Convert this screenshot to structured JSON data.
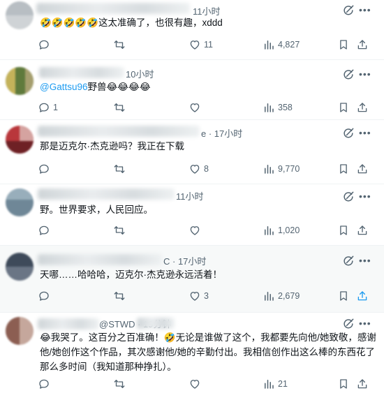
{
  "replies": [
    {
      "time": "11小时",
      "text": "🤣🤣🤣🤣🤣这太准确了，也很有趣，xddd",
      "comments": "",
      "likes": "11",
      "views": "4,827"
    },
    {
      "time": "10小时",
      "mention": "@Gattsu96",
      "text": "野兽😂😂😂😂",
      "comments": "1",
      "likes": "",
      "views": "358"
    },
    {
      "time": "e · 17小时",
      "text": "那是迈克尔·杰克逊吗？我正在下载",
      "comments": "",
      "likes": "8",
      "views": "9,770"
    },
    {
      "time": "11小时",
      "text": "野。世界要求，人民回应。",
      "comments": "",
      "likes": "",
      "views": "1,020"
    },
    {
      "time": "C · 17小时",
      "text": "天哪……哈哈哈，迈克尔·杰克逊永远活着！",
      "comments": "",
      "likes": "3",
      "views": "2,679"
    },
    {
      "time": "@STWD · 19分钟",
      "text": "😂我哭了。这百分之百准确！🤣无论是谁做了这个，我都要先向他/她致敬，感谢他/她创作这个作品，其次感谢他/她的辛勤付出。我相信创作出这么棒的东西花了那么多时间（我知道那种挣扎）。",
      "comments": "",
      "likes": "",
      "views": "21"
    }
  ],
  "colors": {
    "accent": "#1d9bf0",
    "muted": "#536471",
    "text": "#0f1419"
  },
  "icons": [
    "grok-icon",
    "more-icon",
    "reply-icon",
    "retweet-icon",
    "like-icon",
    "views-icon",
    "bookmark-icon",
    "share-icon"
  ]
}
